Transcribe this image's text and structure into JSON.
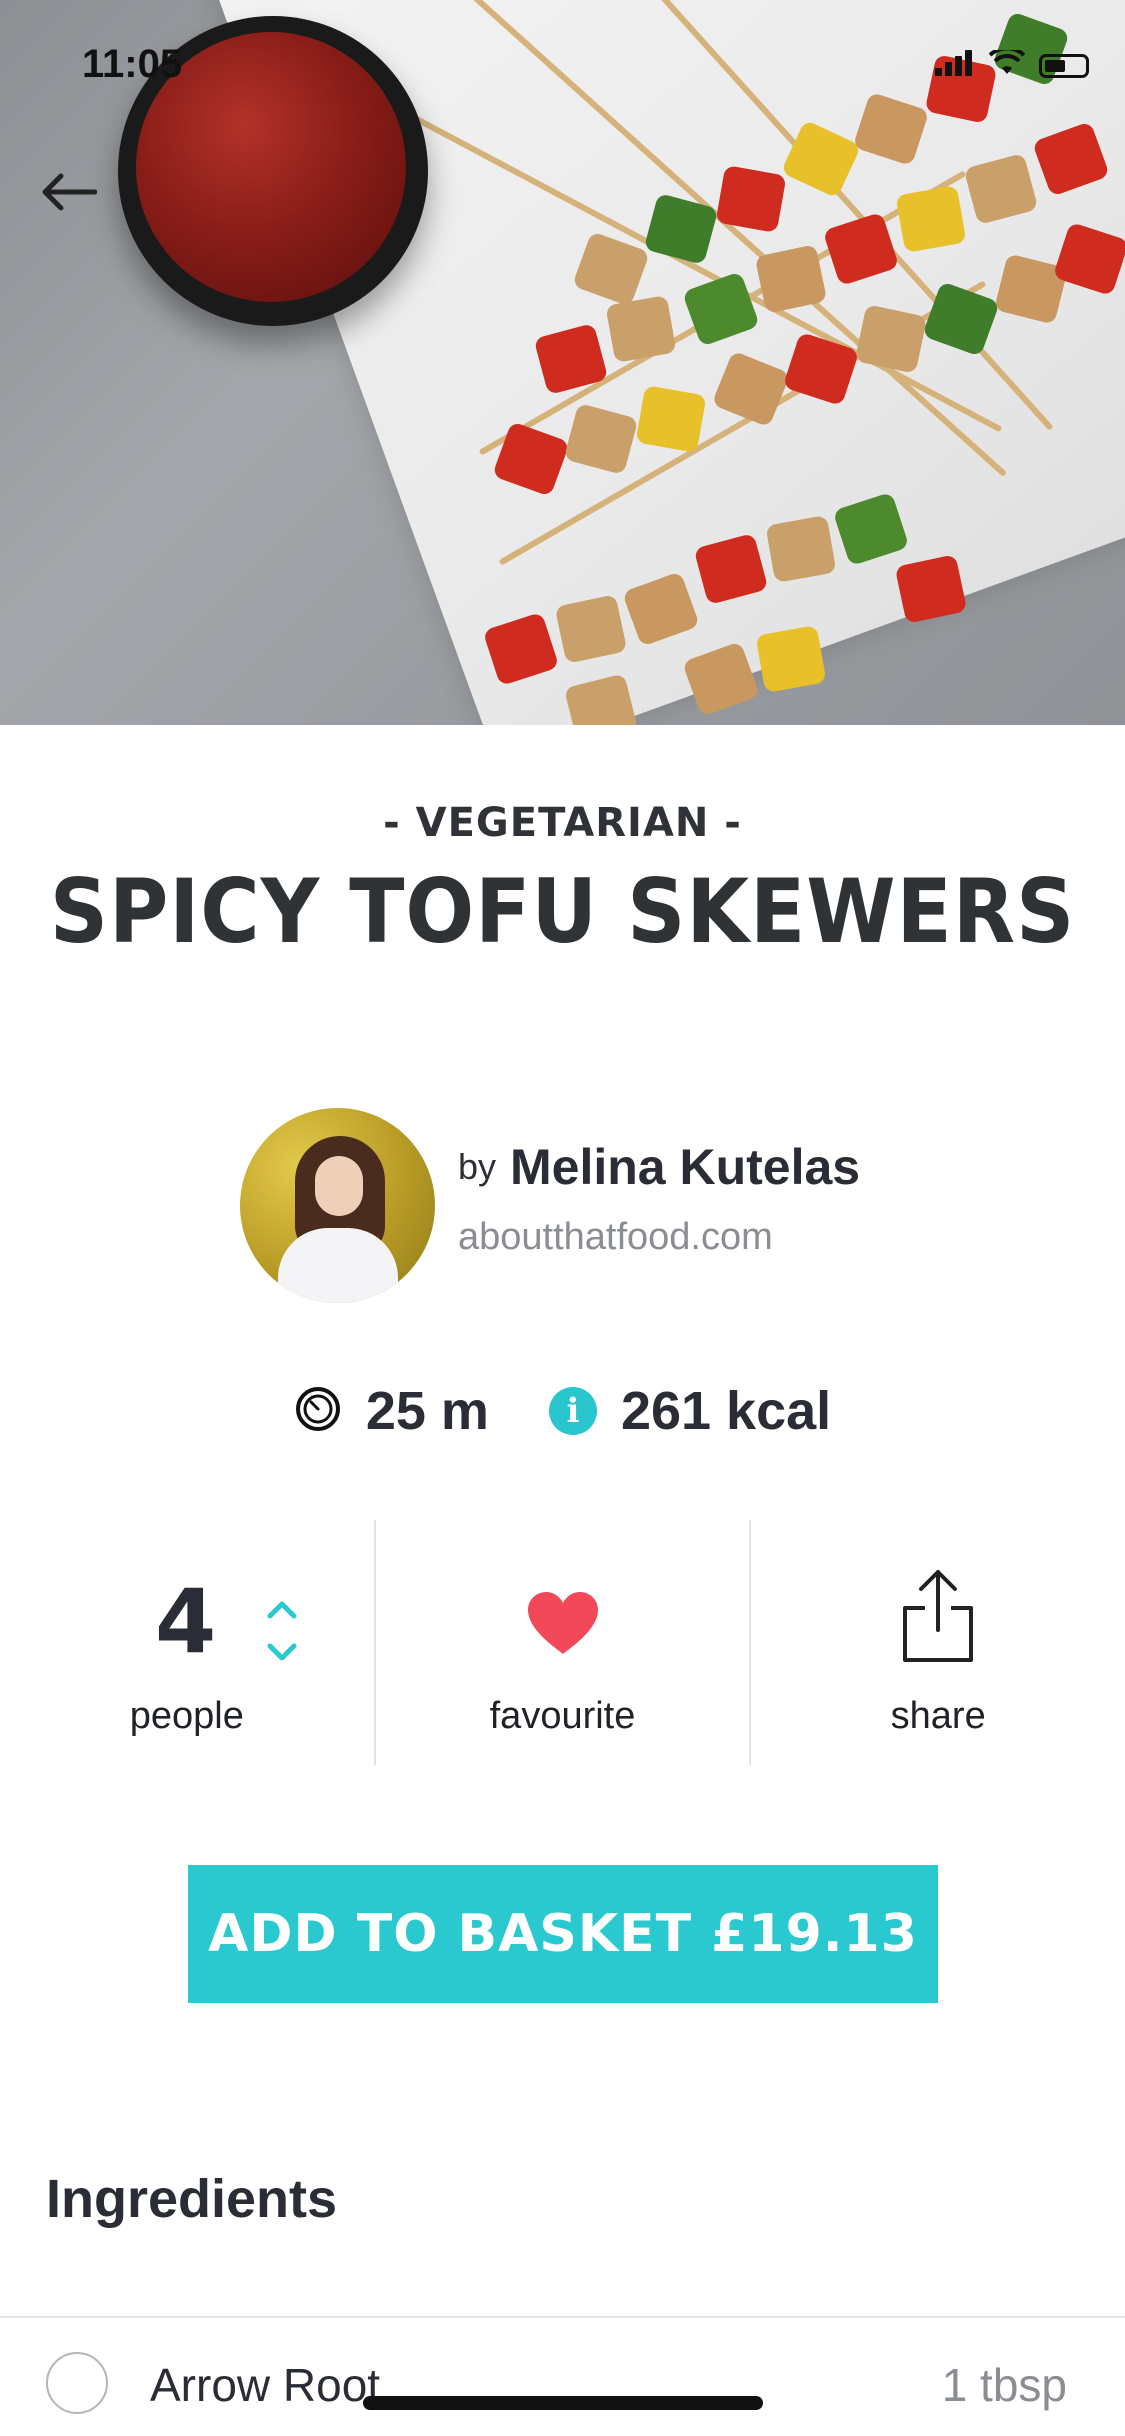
{
  "status_bar": {
    "time": "11:05"
  },
  "nav": {
    "back_icon": "arrow-left-icon"
  },
  "recipe": {
    "category": "- VEGETARIAN -",
    "title": "SPICY TOFU SKEWERS"
  },
  "author": {
    "by": "by",
    "name": "Melina Kutelas",
    "website": "aboutthatfood.com"
  },
  "stats": {
    "time": "25 m",
    "time_icon": "timer-icon",
    "calories": "261 kcal",
    "calories_icon": "info-icon"
  },
  "actions": {
    "people_count": "4",
    "people_label": "people",
    "favourite_label": "favourite",
    "favourite_icon": "heart-icon",
    "share_label": "share",
    "share_icon": "share-icon"
  },
  "cta": {
    "label": "ADD TO BASKET £19.13"
  },
  "ingredients": {
    "heading": "Ingredients",
    "items": [
      {
        "name": "Arrow Root",
        "quantity": "1 tbsp"
      }
    ]
  },
  "colors": {
    "accent": "#29c9cf",
    "heart": "#f2495a",
    "text_dark": "#2a2d35",
    "text_muted": "#8a8d91"
  }
}
